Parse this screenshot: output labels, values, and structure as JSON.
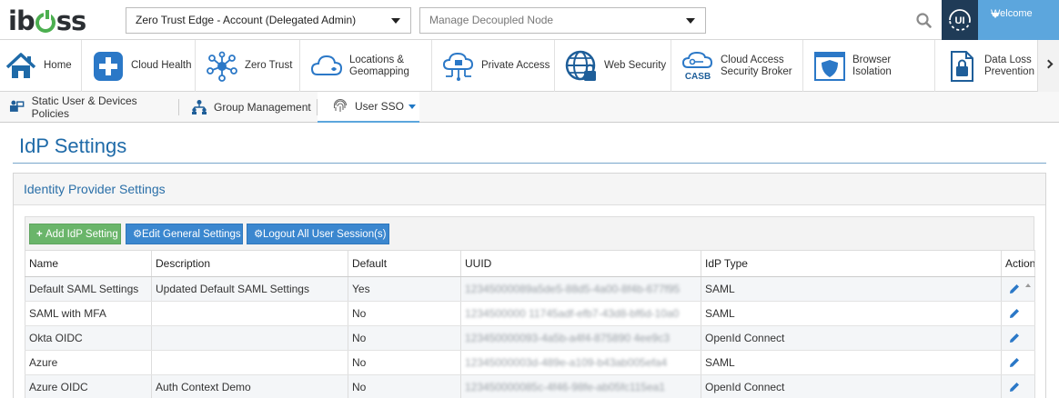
{
  "brand": {
    "logo_left": "ib",
    "logo_right": "ss"
  },
  "header": {
    "account_select": "Zero Trust Edge - Account (Delegated Admin)",
    "node_select": "Manage Decoupled Node",
    "ui_badge": "UI",
    "welcome": "Welcome"
  },
  "modules": [
    {
      "label": "Home",
      "icon": "home-icon"
    },
    {
      "label": "Cloud Health",
      "icon": "plus-icon"
    },
    {
      "label": "Zero Trust",
      "icon": "network-icon"
    },
    {
      "label_line1": "Locations &",
      "label_line2": "Geomapping",
      "icon": "cloud-icon"
    },
    {
      "label": "Private Access",
      "icon": "cloud-network-icon"
    },
    {
      "label": "Web Security",
      "icon": "globe-lock-icon"
    },
    {
      "label_line1": "Cloud Access",
      "label_line2": "Security Broker",
      "icon": "casb-icon",
      "badge": "CASB"
    },
    {
      "label_line1": "Browser",
      "label_line2": "Isolation",
      "icon": "browser-shield-icon"
    },
    {
      "label_line1": "Data Loss",
      "label_line2": "Prevention",
      "icon": "file-lock-icon"
    }
  ],
  "subnav": {
    "items": [
      {
        "label": "Static User & Devices Policies"
      },
      {
        "label": "Group Management"
      },
      {
        "label": "User SSO"
      }
    ]
  },
  "page": {
    "title": "IdP Settings"
  },
  "panel": {
    "title": "Identity Provider Settings",
    "buttons": {
      "add": "Add IdP Setting",
      "edit": "Edit General Settings",
      "logout": "Logout All User Session(s)"
    },
    "columns": [
      "Name",
      "Description",
      "Default",
      "UUID",
      "IdP Type",
      "Action"
    ],
    "rows": [
      {
        "name": "Default SAML Settings",
        "description": "Updated Default SAML Settings",
        "default": "Yes",
        "uuid": "12345000089a5de5-88d5-4a00-8f4b-677f95",
        "type": "SAML"
      },
      {
        "name": "SAML with MFA",
        "description": "",
        "default": "No",
        "uuid": "1234500000 11745adf-efb7-43d8-bf6d-10a0",
        "type": "SAML"
      },
      {
        "name": "Okta OIDC",
        "description": "",
        "default": "No",
        "uuid": "123450000093-4a5b-a4f4-875890 4ee9c3",
        "type": "OpenId Connect"
      },
      {
        "name": "Azure",
        "description": "",
        "default": "No",
        "uuid": "12345000003d-489e-a109-b43ab005efa4",
        "type": "SAML"
      },
      {
        "name": "Azure OIDC",
        "description": "Auth Context Demo",
        "default": "No",
        "uuid": "123450000085c-4f46-98fe-ab05fc115ea1",
        "type": "OpenId Connect"
      }
    ]
  },
  "colors": {
    "accent": "#1e6aa8",
    "welcome_bg": "#5ca6dd",
    "badge_bg": "#1f3b57",
    "green": "#6ab56a",
    "blue": "#3b87cf"
  }
}
